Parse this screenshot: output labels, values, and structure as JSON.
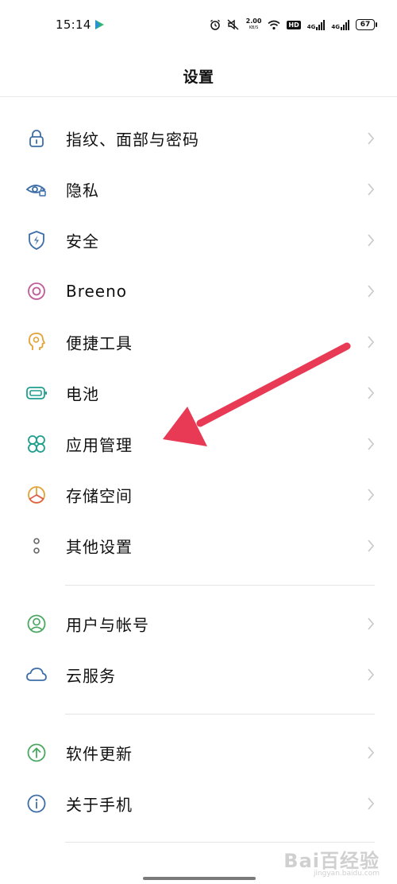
{
  "status_bar": {
    "time": "15:14",
    "speed_value": "2.00",
    "speed_unit": "KB/S",
    "hd": "HD",
    "net1": "4G",
    "net2": "4G",
    "battery": "67"
  },
  "header": {
    "title": "设置"
  },
  "groups": [
    {
      "items": [
        {
          "label": "指纹、面部与密码",
          "icon": "lock-icon",
          "color": "#3d6ea8"
        },
        {
          "label": "隐私",
          "icon": "privacy-eye-icon",
          "color": "#3d6ea8"
        },
        {
          "label": "安全",
          "icon": "shield-icon",
          "color": "#3d6ea8"
        },
        {
          "label": "Breeno",
          "icon": "breeno-icon",
          "color": "#c05a9a"
        },
        {
          "label": "便捷工具",
          "icon": "tools-head-icon",
          "color": "#e3a336"
        },
        {
          "label": "电池",
          "icon": "battery-icon",
          "color": "#1f9e8e"
        },
        {
          "label": "应用管理",
          "icon": "apps-clover-icon",
          "color": "#1f9e8e"
        },
        {
          "label": "存储空间",
          "icon": "storage-pie-icon",
          "color": "#e3a336"
        },
        {
          "label": "其他设置",
          "icon": "more-dots-icon",
          "color": "#666666"
        }
      ]
    },
    {
      "items": [
        {
          "label": "用户与帐号",
          "icon": "user-icon",
          "color": "#4aa862"
        },
        {
          "label": "云服务",
          "icon": "cloud-icon",
          "color": "#3d6ea8"
        }
      ]
    },
    {
      "items": [
        {
          "label": "软件更新",
          "icon": "update-arrow-icon",
          "color": "#4aa862"
        },
        {
          "label": "关于手机",
          "icon": "info-icon",
          "color": "#3d6ea8"
        }
      ]
    }
  ],
  "watermark": {
    "text": "Bai百经验",
    "sub": "jingyan.baidu.com"
  },
  "colors": {
    "arrow": "#e83a55",
    "chevron": "#c8c8c8"
  }
}
